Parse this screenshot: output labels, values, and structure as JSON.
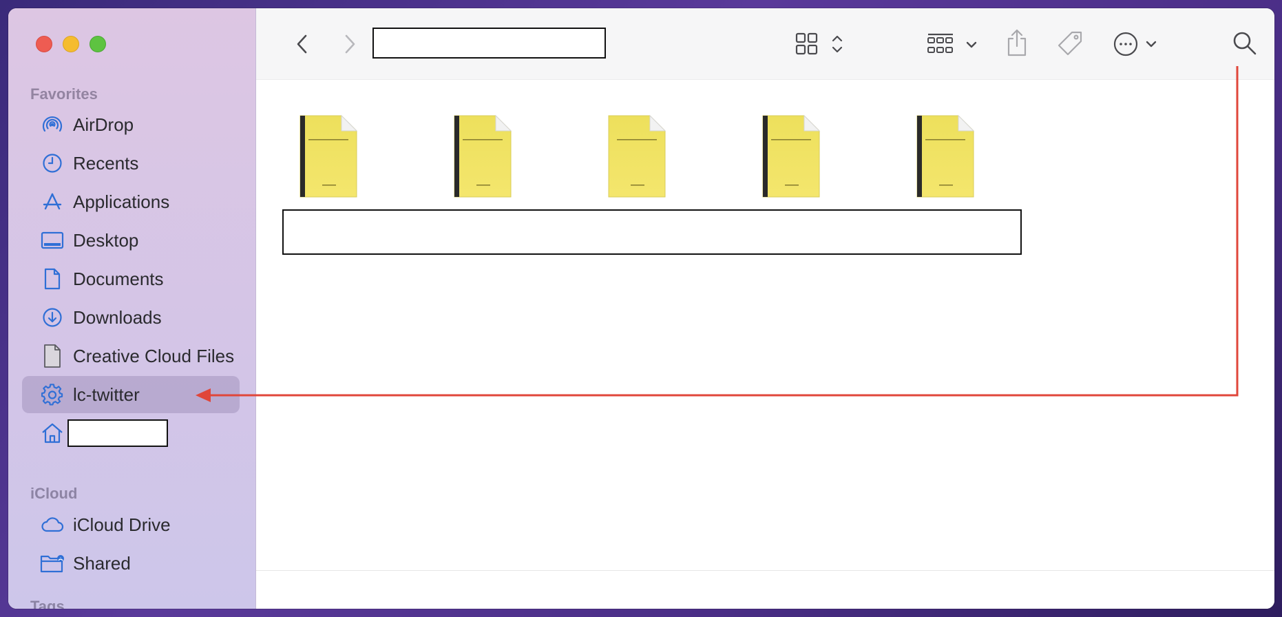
{
  "sidebar": {
    "favorites_title": "Favorites",
    "items": [
      {
        "label": "AirDrop",
        "icon": "airdrop-icon"
      },
      {
        "label": "Recents",
        "icon": "clock-icon"
      },
      {
        "label": "Applications",
        "icon": "applications-icon"
      },
      {
        "label": "Desktop",
        "icon": "desktop-icon"
      },
      {
        "label": "Documents",
        "icon": "document-icon"
      },
      {
        "label": "Downloads",
        "icon": "download-icon"
      },
      {
        "label": "Creative Cloud Files",
        "icon": "file-icon"
      },
      {
        "label": "lc-twitter",
        "icon": "gear-icon",
        "selected": true
      },
      {
        "label": "",
        "icon": "home-icon",
        "redacted": true
      }
    ],
    "icloud_title": "iCloud",
    "icloud_items": [
      {
        "label": "iCloud Drive",
        "icon": "cloud-icon"
      },
      {
        "label": "Shared",
        "icon": "shared-folder-icon"
      }
    ],
    "tags_title": "Tags"
  },
  "toolbar": {
    "path_title": "",
    "buttons": [
      "back",
      "forward",
      "view-grid",
      "group-by",
      "share",
      "tag",
      "more",
      "search"
    ]
  },
  "files": [
    {
      "name": "",
      "style": "bound"
    },
    {
      "name": "",
      "style": "bound"
    },
    {
      "name": "",
      "style": "plain"
    },
    {
      "name": "",
      "style": "bound"
    },
    {
      "name": "",
      "style": "bound"
    }
  ],
  "colors": {
    "accent": "#2f6fd6",
    "annotation": "#e0463a",
    "document": "#f4e66d"
  }
}
